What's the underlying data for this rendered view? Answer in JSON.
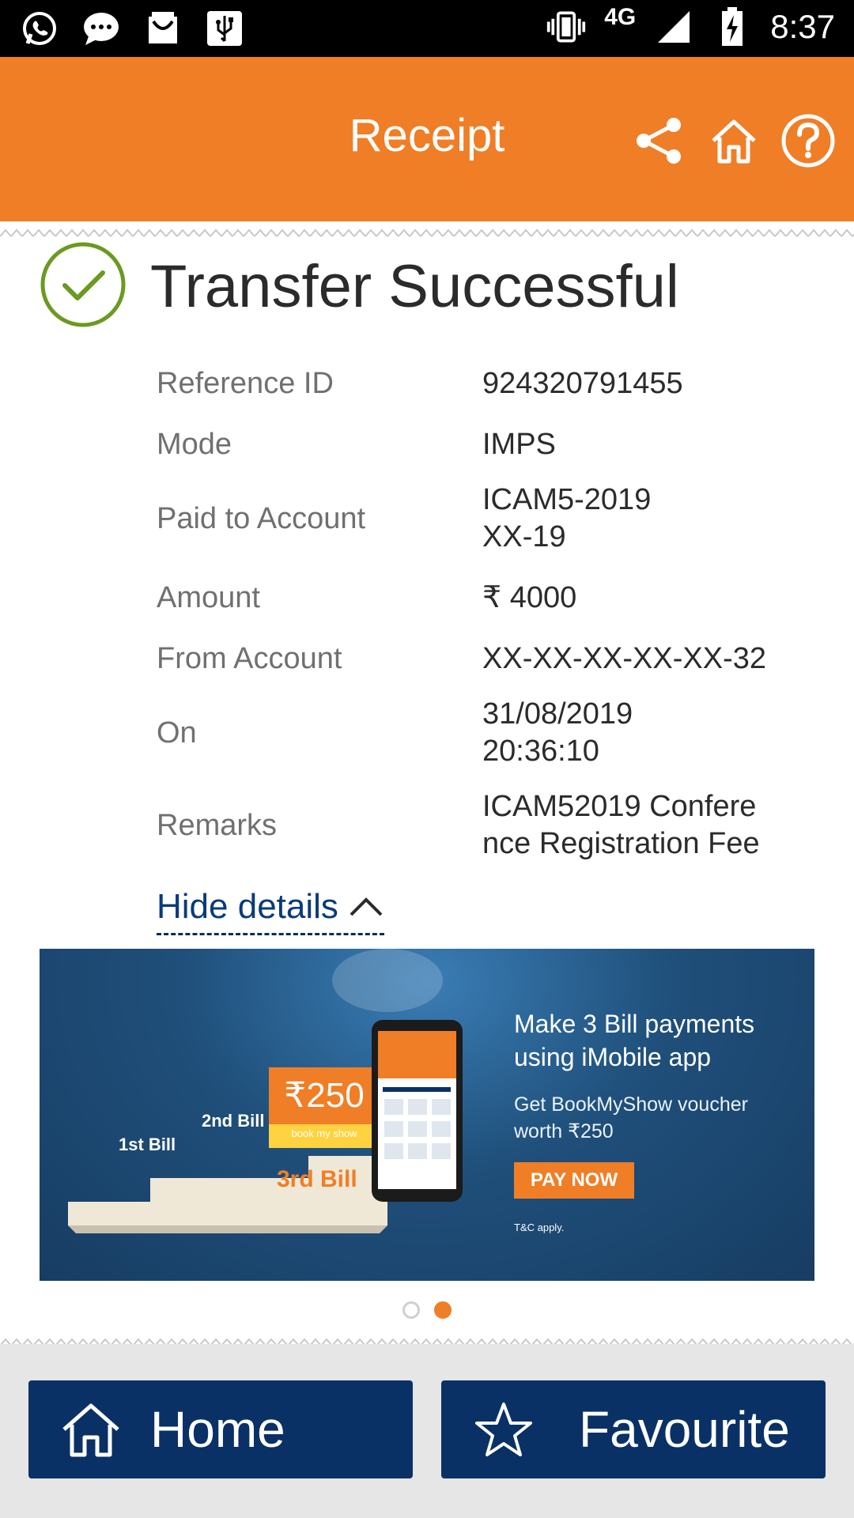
{
  "status_bar": {
    "time": "8:37",
    "network": "4G",
    "left_icons": [
      "whatsapp-icon",
      "message-icon",
      "shopping-icon",
      "usb-icon"
    ],
    "right_icons": [
      "vibrate-icon",
      "signal-icon",
      "battery-charging-icon"
    ]
  },
  "app_bar": {
    "title": "Receipt",
    "actions": [
      "share-icon",
      "home-icon",
      "help-icon"
    ],
    "color": "#F07E26"
  },
  "success": {
    "title": "Transfer Successful",
    "icon": "check-circle-icon",
    "icon_color": "#6a9a1f"
  },
  "details": [
    {
      "label": "Reference ID",
      "value": "924320791455"
    },
    {
      "label": "Mode",
      "value": "IMPS"
    },
    {
      "label": "Paid to Account",
      "value": "ICAM5-2019",
      "value2": "XX-19"
    },
    {
      "label": "Amount",
      "value": "₹ 4000"
    },
    {
      "label": "From Account",
      "value": "XX-XX-XX-XX-XX-32"
    },
    {
      "label": "On",
      "value": "31/08/2019",
      "value2": "20:36:10"
    },
    {
      "label": "Remarks",
      "value": "ICAM52019 Confere",
      "value2": "nce Registration Fee"
    }
  ],
  "toggle": {
    "label": "Hide details"
  },
  "banner": {
    "headline": "Make 3 Bill payments using iMobile app",
    "subtext": "Get BookMyShow voucher worth ₹250",
    "cta": "PAY NOW",
    "tnc": "T&C apply.",
    "step1": "1st Bill",
    "step2": "2nd Bill",
    "step3": "3rd Bill",
    "voucher": "₹250",
    "voucher_brand": "book my show"
  },
  "carousel": {
    "count": 2,
    "active": 2
  },
  "footer": {
    "home_label": "Home",
    "favourite_label": "Favourite",
    "button_color": "#0a3166"
  }
}
